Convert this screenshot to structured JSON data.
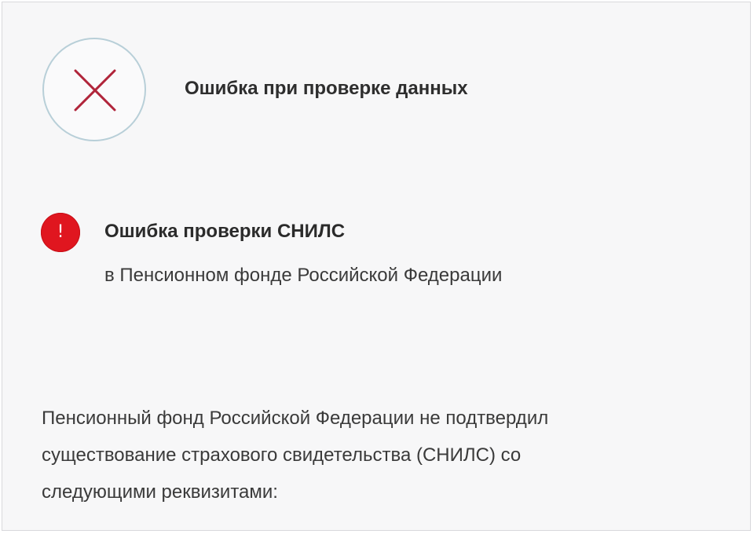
{
  "header": {
    "status_icon": "close-x-icon",
    "title": "Ошибка при проверке данных"
  },
  "alert": {
    "icon": "exclamation-icon",
    "icon_glyph": "!",
    "title": "Ошибка проверки СНИЛС",
    "subtitle": "в Пенсионном фонде Российской Федерации"
  },
  "message": {
    "lines": [
      "Пенсионный фонд Российской Федерации не подтвердил",
      "существование страхового свидетельства (СНИЛС) со",
      "следующими реквизитами:"
    ]
  },
  "colors": {
    "error_red": "#e0161f",
    "x_mark": "#b0243a",
    "circle_border": "#b8cfd8",
    "background": "#f7f7f8"
  }
}
